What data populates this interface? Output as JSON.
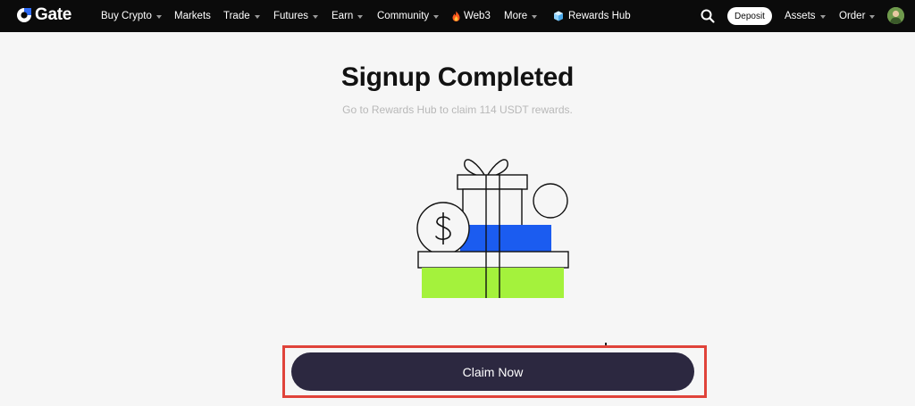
{
  "brand": {
    "name": "Gate"
  },
  "nav": {
    "items": [
      {
        "label": "Buy Crypto",
        "dropdown": true
      },
      {
        "label": "Markets",
        "dropdown": false
      },
      {
        "label": "Trade",
        "dropdown": true
      },
      {
        "label": "Futures",
        "dropdown": true
      },
      {
        "label": "Earn",
        "dropdown": true
      },
      {
        "label": "Community",
        "dropdown": true
      },
      {
        "label": "Web3",
        "dropdown": false,
        "icon": "fire-icon"
      },
      {
        "label": "More",
        "dropdown": true
      },
      {
        "label": "Rewards Hub",
        "dropdown": false,
        "icon": "rewards-hub-icon"
      }
    ],
    "right": {
      "search_icon": "search-icon",
      "deposit_label": "Deposit",
      "assets_label": "Assets",
      "order_label": "Order",
      "avatar_icon": "user-avatar"
    }
  },
  "main": {
    "title": "Signup Completed",
    "subtitle": "Go to Rewards Hub to claim 114 USDT rewards.",
    "illustration": "gift-box-with-coin-illustration",
    "claim_label": "Claim Now"
  },
  "colors": {
    "nav_bg": "#0b0b0b",
    "page_bg": "#f6f6f6",
    "blue_block": "#1b5cf0",
    "green_block": "#a4f23c",
    "claim_button": "#2c2840",
    "highlight_border": "#e0433a",
    "brand_blue": "#2f6cf6"
  }
}
